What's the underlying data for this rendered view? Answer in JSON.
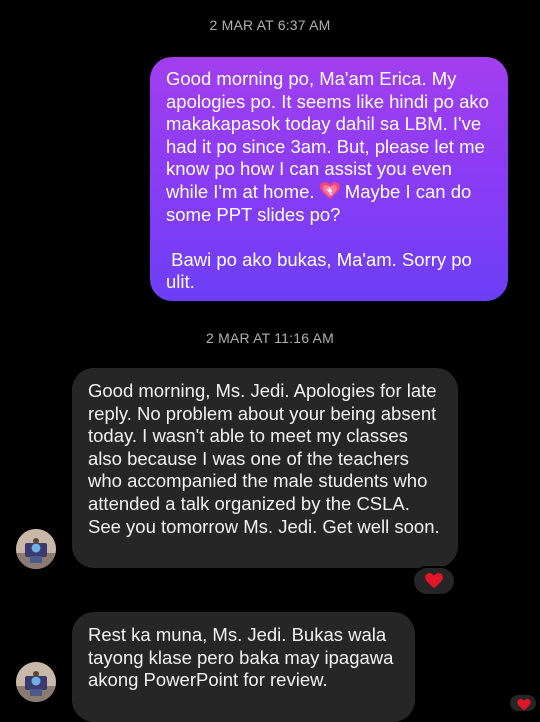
{
  "colors": {
    "background": "#000000",
    "outgoing_bubble_top": "#a23ef0",
    "outgoing_bubble_bottom": "#6c3ef6",
    "incoming_bubble": "#262626",
    "timestamp_text": "#b0b0b0",
    "heart": "#e0162b"
  },
  "messages": {
    "ts1": "2 MAR AT 6:37 AM",
    "out1": {
      "part1": "Good morning po, Ma'am Erica. My apologies po. It seems like hindi po ako makakapasok today dahil sa LBM. I've had it po since 3am. But, please let me know po how I can assist you even while I'm at home. ",
      "emoji": "sparkling-heart-icon",
      "part2": " Maybe I can do some PPT slides po?\n\n Bawi po ako bukas, Ma'am. Sorry po ulit."
    },
    "ts2": "2 MAR AT 11:16 AM",
    "in1": "Good morning, Ms. Jedi. Apologies for late reply. No problem about your being absent today. I wasn't able to meet my classes also because I was one of the teachers who accompanied the male students who attended a talk organized by the CSLA. See you tomorrow Ms. Jedi. Get well soon.",
    "in1_reaction": "heart-icon",
    "in2": "Rest ka muna, Ms. Jedi. Bukas wala tayong klase pero baka may ipagawa akong PowerPoint for review."
  }
}
